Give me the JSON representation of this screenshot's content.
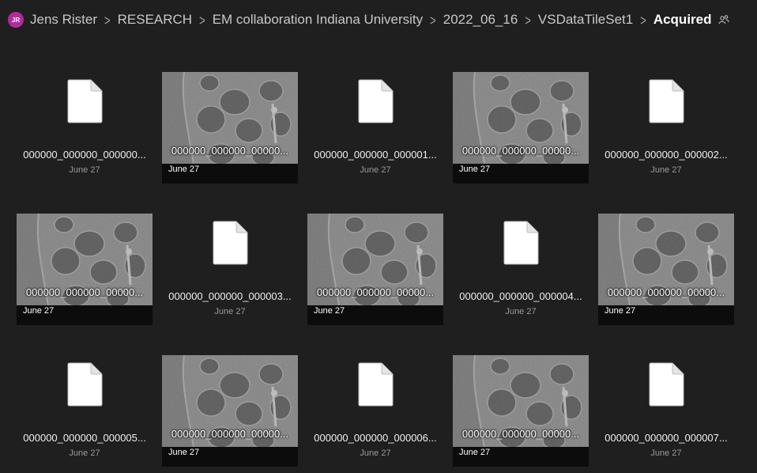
{
  "breadcrumb": {
    "avatar_initials": "JR",
    "items": [
      "Jens Rister",
      "RESEARCH",
      "EM collaboration Indiana University",
      "2022_06_16",
      "VSDataTileSet1"
    ],
    "current": "Acquired"
  },
  "files": [
    {
      "name": "000000_000000_000000...",
      "date": "June 27",
      "kind": "file"
    },
    {
      "name": "000000_000000_00000...",
      "date": "June 27",
      "kind": "image"
    },
    {
      "name": "000000_000000_000001...",
      "date": "June 27",
      "kind": "file"
    },
    {
      "name": "000000_000000_00000...",
      "date": "June 27",
      "kind": "image"
    },
    {
      "name": "000000_000000_000002...",
      "date": "June 27",
      "kind": "file"
    },
    {
      "name": "000000_000000_00000...",
      "date": "June 27",
      "kind": "image"
    },
    {
      "name": "000000_000000_000003...",
      "date": "June 27",
      "kind": "file"
    },
    {
      "name": "000000_000000_00000...",
      "date": "June 27",
      "kind": "image"
    },
    {
      "name": "000000_000000_000004...",
      "date": "June 27",
      "kind": "file"
    },
    {
      "name": "000000_000000_00000...",
      "date": "June 27",
      "kind": "image"
    },
    {
      "name": "000000_000000_000005...",
      "date": "June 27",
      "kind": "file"
    },
    {
      "name": "000000_000000_00000...",
      "date": "June 27",
      "kind": "image"
    },
    {
      "name": "000000_000000_000006...",
      "date": "June 27",
      "kind": "file"
    },
    {
      "name": "000000_000000_00000...",
      "date": "June 27",
      "kind": "image"
    },
    {
      "name": "000000_000000_000007...",
      "date": "June 27",
      "kind": "file"
    }
  ],
  "colors": {
    "background": "#1f1f1f",
    "avatar": "#b32b9e",
    "tile_footer": "#0c0c0c"
  },
  "icons": {
    "file": "document-icon",
    "share": "shared-people-icon",
    "separator": "chevron-right-icon"
  }
}
